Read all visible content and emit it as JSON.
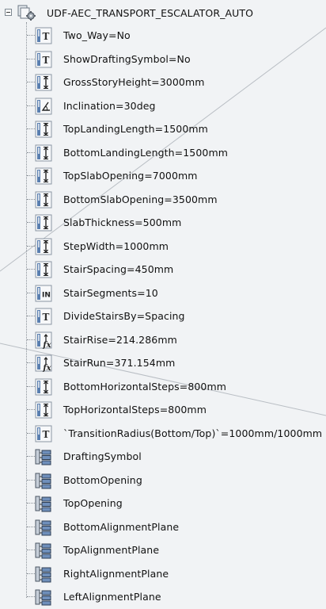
{
  "root": {
    "label": "UDF-AEC_TRANSPORT_ESCALATOR_AUTO",
    "icon": "udf-gear-icon",
    "expanded": true
  },
  "parameters": [
    {
      "label": "Two_Way=No",
      "icon": "text-param-icon"
    },
    {
      "label": "ShowDraftingSymbol=No",
      "icon": "text-param-icon"
    },
    {
      "label": "GrossStoryHeight=3000mm",
      "icon": "length-param-icon"
    },
    {
      "label": "Inclination=30deg",
      "icon": "angle-param-icon"
    },
    {
      "label": "TopLandingLength=1500mm",
      "icon": "length-param-icon"
    },
    {
      "label": "BottomLandingLength=1500mm",
      "icon": "length-param-icon"
    },
    {
      "label": "TopSlabOpening=7000mm",
      "icon": "length-param-icon"
    },
    {
      "label": "BottomSlabOpening=3500mm",
      "icon": "length-param-icon"
    },
    {
      "label": "SlabThickness=500mm",
      "icon": "length-param-icon"
    },
    {
      "label": "StepWidth=1000mm",
      "icon": "length-param-icon"
    },
    {
      "label": "StairSpacing=450mm",
      "icon": "length-param-icon"
    },
    {
      "label": "StairSegments=10",
      "icon": "integer-param-icon"
    },
    {
      "label": "DivideStairsBy=Spacing",
      "icon": "text-param-icon"
    },
    {
      "label": "StairRise=214.286mm",
      "icon": "formula-length-param-icon"
    },
    {
      "label": "StairRun=371.154mm",
      "icon": "formula-length-param-icon"
    },
    {
      "label": "BottomHorizontalSteps=800mm",
      "icon": "length-param-icon"
    },
    {
      "label": "TopHorizontalSteps=800mm",
      "icon": "length-param-icon"
    },
    {
      "label": "`TransitionRadius(Bottom/Top)`=1000mm/1000mm",
      "icon": "text-param-icon"
    },
    {
      "label": "DraftingSymbol",
      "icon": "geometry-set-icon"
    },
    {
      "label": "BottomOpening",
      "icon": "geometry-set-icon"
    },
    {
      "label": "TopOpening",
      "icon": "geometry-set-icon"
    },
    {
      "label": "BottomAlignmentPlane",
      "icon": "geometry-set-icon"
    },
    {
      "label": "TopAlignmentPlane",
      "icon": "geometry-set-icon"
    },
    {
      "label": "RightAlignmentPlane",
      "icon": "geometry-set-icon"
    },
    {
      "label": "LeftAlignmentPlane",
      "icon": "geometry-set-icon"
    }
  ],
  "colors": {
    "background": "#f1f3f5",
    "icon_blue": "#5a7fb0",
    "tree_line": "#8a9097",
    "viewport_line": "#b9bec4"
  }
}
